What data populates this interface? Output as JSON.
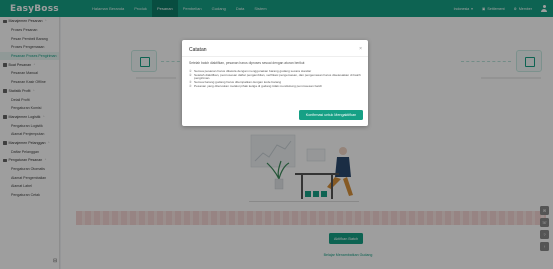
{
  "app": {
    "logo": "EasyBoss"
  },
  "nav": {
    "items": [
      "Halaman Beranda",
      "Produk",
      "Pesanan",
      "Pembelian",
      "Gudang",
      "Data",
      "Sistem"
    ],
    "active_index": 2
  },
  "topbar_right": {
    "language": "Indonesia",
    "settlement": "Settlement",
    "member": "Member"
  },
  "sidebar": {
    "items": [
      {
        "type": "group",
        "label": "Manajemen Pesanan"
      },
      {
        "type": "item",
        "label": "Proses Pesanan"
      },
      {
        "type": "item",
        "label": "Pesan Pembeli Barang"
      },
      {
        "type": "item",
        "label": "Proses Pengemasan"
      },
      {
        "type": "item",
        "label": "Pesanan Proses Pengiriman",
        "active": true
      },
      {
        "type": "group",
        "label": "Buat Pesanan"
      },
      {
        "type": "item",
        "label": "Pesanan Manual"
      },
      {
        "type": "item",
        "label": "Pesanan Kasir Offline"
      },
      {
        "type": "group",
        "label": "Statistik Profit"
      },
      {
        "type": "item",
        "label": "Detail Profit"
      },
      {
        "type": "item",
        "label": "Pengaturan Komisi"
      },
      {
        "type": "group",
        "label": "Manajemen Logistik"
      },
      {
        "type": "item",
        "label": "Pengaturan Logistik"
      },
      {
        "type": "item",
        "label": "Alamat Penjemputan"
      },
      {
        "type": "group",
        "label": "Manajemen Pelanggan"
      },
      {
        "type": "item",
        "label": "Daftar Pelanggan"
      },
      {
        "type": "group",
        "label": "Pengaturan Pesanan"
      },
      {
        "type": "item",
        "label": "Pengaturan Otomatis"
      },
      {
        "type": "item",
        "label": "Alamat Pengembalian"
      },
      {
        "type": "item",
        "label": "Alamat Label"
      },
      {
        "type": "item",
        "label": "Pengaturan Cetak"
      }
    ]
  },
  "main": {
    "button_label": "Aktifkan Batch",
    "link_label": "Belajar Menambatkan Gudang"
  },
  "modal": {
    "title": "Catatan",
    "intro": "Setelah batch diaktifkan, pesanan harus diproses sesuai dengan aturan berikut",
    "rules": [
      "Semua pesanan harus dikelola dengan menggunakan barang gudang secara standar",
      "Setelah diaktifkan, pemrosesan daftar pengambilan, verifikasi pengemasan, dan pengemasan harus diselesaikan di batch pengiriman.",
      "Semua barang gudang harus ditempatkan dengan kode barang",
      "Pesanan yang diteruskan melalui pihak ketiga di gudang tidak mendukung pemrosesan batch"
    ],
    "confirm_label": "Konfirmasi untuk Mengaktifkan"
  }
}
